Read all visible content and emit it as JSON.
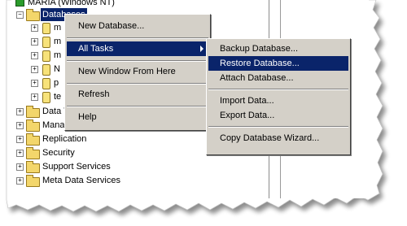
{
  "window": {
    "title": "MARIA (Windows NT)"
  },
  "tree": {
    "databases_label": "Databases",
    "db_items": [
      "m",
      "m",
      "m",
      "N",
      "p",
      "te"
    ],
    "folders": [
      "Data Transformation Services",
      "Management",
      "Replication",
      "Security",
      "Support Services",
      "Meta Data Services"
    ]
  },
  "context_menu": {
    "new_database": "New Database...",
    "all_tasks": "All Tasks",
    "new_window": "New Window From Here",
    "refresh": "Refresh",
    "help": "Help"
  },
  "submenu": {
    "backup": "Backup Database...",
    "restore": "Restore Database...",
    "attach": "Attach Database...",
    "import": "Import Data...",
    "export": "Export Data...",
    "copy_wizard": "Copy Database Wizard..."
  }
}
